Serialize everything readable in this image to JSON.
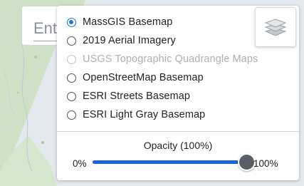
{
  "search": {
    "placeholder": "Ent"
  },
  "basemap_panel": {
    "layers": [
      {
        "label": "MassGIS Basemap",
        "selected": true,
        "disabled": false
      },
      {
        "label": "2019 Aerial Imagery",
        "selected": false,
        "disabled": false
      },
      {
        "label": "USGS Topographic Quadrangle Maps",
        "selected": false,
        "disabled": true
      },
      {
        "label": "OpenStreetMap Basemap",
        "selected": false,
        "disabled": false
      },
      {
        "label": "ESRI Streets Basemap",
        "selected": false,
        "disabled": false
      },
      {
        "label": "ESRI Light Gray Basemap",
        "selected": false,
        "disabled": false
      }
    ],
    "layers_button_icon": "layers-icon",
    "opacity": {
      "title": "Opacity (100%)",
      "min_label": "0%",
      "max_label": "100%",
      "value_percent": 100
    }
  },
  "colors": {
    "accent": "#1a73e8",
    "slider_fill": "#1a63d6",
    "slider_thumb": "#5a5f66",
    "disabled_text": "#b0b0b0"
  }
}
